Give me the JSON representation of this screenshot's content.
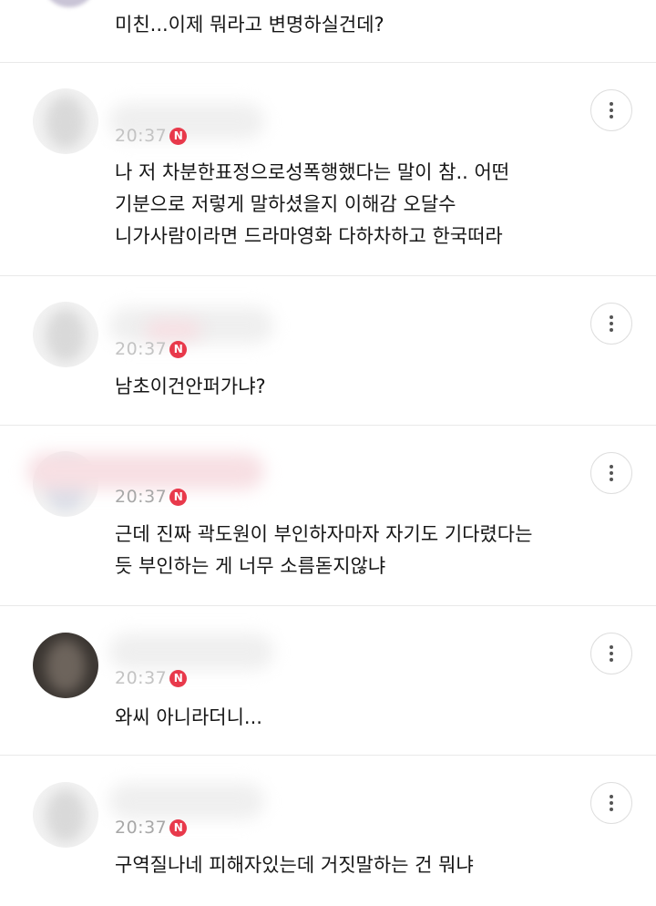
{
  "comments": [
    {
      "time": "",
      "text": "미친...이제 뭐라고 변명하실건데?"
    },
    {
      "time": "20:37",
      "badge": "N",
      "text": "나 저 차분한표정으로성폭행했다는 말이 참.. 어떤\n기분으로 저렇게 말하셨을지 이해감 오달수\n니가사람이라면 드라마영화 다하차하고 한국떠라"
    },
    {
      "time": "20:37",
      "badge": "N",
      "text": "남초이건안퍼가냐?"
    },
    {
      "time": "20:37",
      "badge": "N",
      "text": "근데 진짜 곽도원이 부인하자마자 자기도 기다렸다는\n듯 부인하는 게 너무 소름돋지않냐"
    },
    {
      "time": "20:37",
      "badge": "N",
      "text": "와씨 아니라더니..."
    },
    {
      "time": "20:37",
      "badge": "N",
      "text": "구역질나네 피해자있는데 거짓말하는 건 뭐냐"
    }
  ],
  "icons": {
    "more": "more-vertical-icon",
    "new": "new-badge-icon"
  },
  "colors": {
    "badge": "#e8394b",
    "time": "#a7a7a7",
    "divider": "#e9e9e9"
  }
}
